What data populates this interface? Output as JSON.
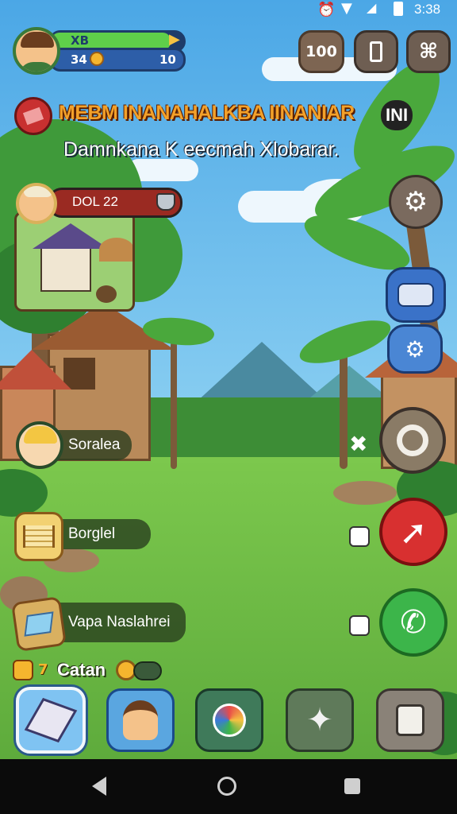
{
  "status_bar": {
    "time": "3:38"
  },
  "player": {
    "level_label": "XB",
    "coins": "34",
    "score": "10"
  },
  "top_buttons": {
    "count": "100"
  },
  "announcement": {
    "title": "MEBM INANAHALKBA IINANIAR",
    "title_suffix": "INI",
    "subtitle": "Damnkana K eecmah Xlobarar."
  },
  "village_card": {
    "label": "DOL 22"
  },
  "menu_items": [
    {
      "label": "Soralea"
    },
    {
      "label": "Borglel"
    },
    {
      "label": "Vapa Naslahrei"
    }
  ],
  "currency": {
    "label": "Catan",
    "prefix": "7"
  },
  "colors": {
    "sky": "#5fb1e6",
    "grass": "#6dbb45",
    "accent_red": "#d83030",
    "call_green": "#3cb54a",
    "hp_green": "#5fcf4a",
    "bar_blue": "#2d5ea8"
  },
  "icons": {
    "right_column": [
      "gear-icon",
      "chat-bubble-icon",
      "cog-badge-icon",
      "target-icon",
      "arrow-up-icon",
      "phone-icon"
    ],
    "bottom_bar": [
      "gem-box-icon",
      "profile-icon",
      "chat-icon",
      "puzzle-icon",
      "settings-box-icon"
    ]
  }
}
